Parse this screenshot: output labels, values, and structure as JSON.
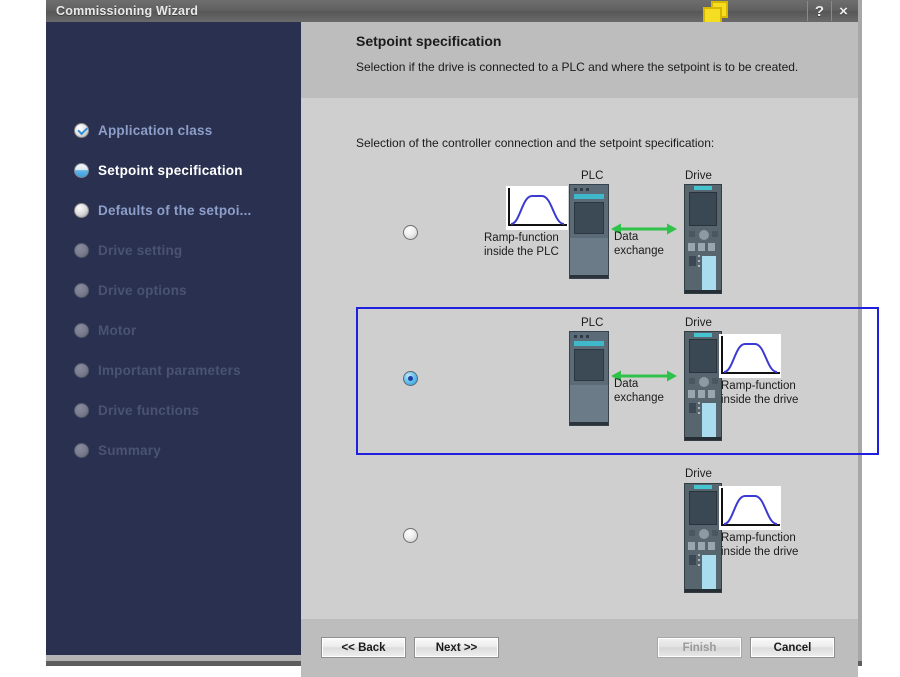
{
  "window": {
    "title": "Commissioning Wizard",
    "cascade_icon": "cascade-windows-icon",
    "help_label": "?",
    "close_label": "×"
  },
  "sidebar": {
    "items": [
      {
        "label": "Application class",
        "state": "done"
      },
      {
        "label": "Setpoint specification",
        "state": "current"
      },
      {
        "label": "Defaults of the setpoi...",
        "state": "todo"
      },
      {
        "label": "Drive setting",
        "state": "disabled"
      },
      {
        "label": "Drive options",
        "state": "disabled"
      },
      {
        "label": "Motor",
        "state": "disabled"
      },
      {
        "label": "Important parameters",
        "state": "disabled"
      },
      {
        "label": "Drive functions",
        "state": "disabled"
      },
      {
        "label": "Summary",
        "state": "disabled"
      }
    ]
  },
  "header": {
    "title": "Setpoint specification",
    "subtitle": "Selection if the drive is connected to a PLC and where the setpoint is to be created."
  },
  "body": {
    "intro": "Selection of the controller connection and the setpoint specification:"
  },
  "options": [
    {
      "id": "option-plc-ramp",
      "selected": false,
      "plc_label": "PLC",
      "drive_label": "Drive",
      "exchange_line1": "Data",
      "exchange_line2": "exchange",
      "caption_line1": "Ramp-function",
      "caption_line2": "inside the PLC"
    },
    {
      "id": "option-drive-ramp-with-plc",
      "selected": true,
      "plc_label": "PLC",
      "drive_label": "Drive",
      "exchange_line1": "Data",
      "exchange_line2": "exchange",
      "caption_line1": "Ramp-function",
      "caption_line2": "inside the drive"
    },
    {
      "id": "option-drive-ramp-standalone",
      "selected": false,
      "plc_label": "",
      "drive_label": "Drive",
      "exchange_line1": "",
      "exchange_line2": "",
      "caption_line1": "Ramp-function",
      "caption_line2": "inside the drive"
    }
  ],
  "footer": {
    "back": "<< Back",
    "next": "Next >>",
    "finish": "Finish",
    "cancel": "Cancel"
  },
  "colors": {
    "sidebar_bg": "#2a3050",
    "selection_border": "#1f1fe0",
    "arrow_green": "#2fc24a",
    "ramp_blue": "#3a3ad0",
    "accent_cyan": "#45c3cf"
  }
}
